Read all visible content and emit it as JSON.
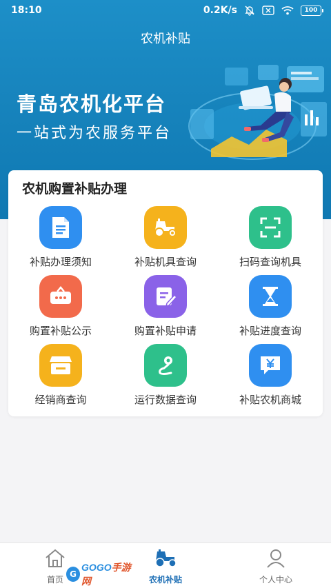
{
  "status_bar": {
    "time": "18:10",
    "network_speed": "0.2K/s",
    "battery": "100"
  },
  "header": {
    "title": "农机补贴"
  },
  "banner": {
    "title": "青岛农机化平台",
    "subtitle": "一站式为农服务平台"
  },
  "section": {
    "title": "农机购置补贴办理",
    "items": [
      {
        "label": "补贴办理须知",
        "icon": "document-icon",
        "color": "#2f8ff0"
      },
      {
        "label": "补贴机具查询",
        "icon": "tractor-icon",
        "color": "#f5b21c"
      },
      {
        "label": "扫码查询机具",
        "icon": "scan-icon",
        "color": "#2ec08b"
      },
      {
        "label": "购置补贴公示",
        "icon": "bulletin-icon",
        "color": "#f26a4b"
      },
      {
        "label": "购置补贴申请",
        "icon": "edit-form-icon",
        "color": "#8a62e8"
      },
      {
        "label": "补贴进度查询",
        "icon": "hourglass-icon",
        "color": "#2f8ff0"
      },
      {
        "label": "经销商查询",
        "icon": "store-icon",
        "color": "#f5b21c"
      },
      {
        "label": "运行数据查询",
        "icon": "location-route-icon",
        "color": "#2ec08b"
      },
      {
        "label": "补贴农机商城",
        "icon": "yuan-chat-icon",
        "color": "#2f8ff0"
      }
    ]
  },
  "tabbar": {
    "items": [
      {
        "label": "首页",
        "icon": "home-icon"
      },
      {
        "label": "农机补贴",
        "icon": "tractor-icon"
      },
      {
        "label": "个人中心",
        "icon": "person-icon"
      }
    ],
    "active_index": 1
  },
  "watermark": {
    "prefix": "GOGO",
    "suffix": "手游网"
  }
}
